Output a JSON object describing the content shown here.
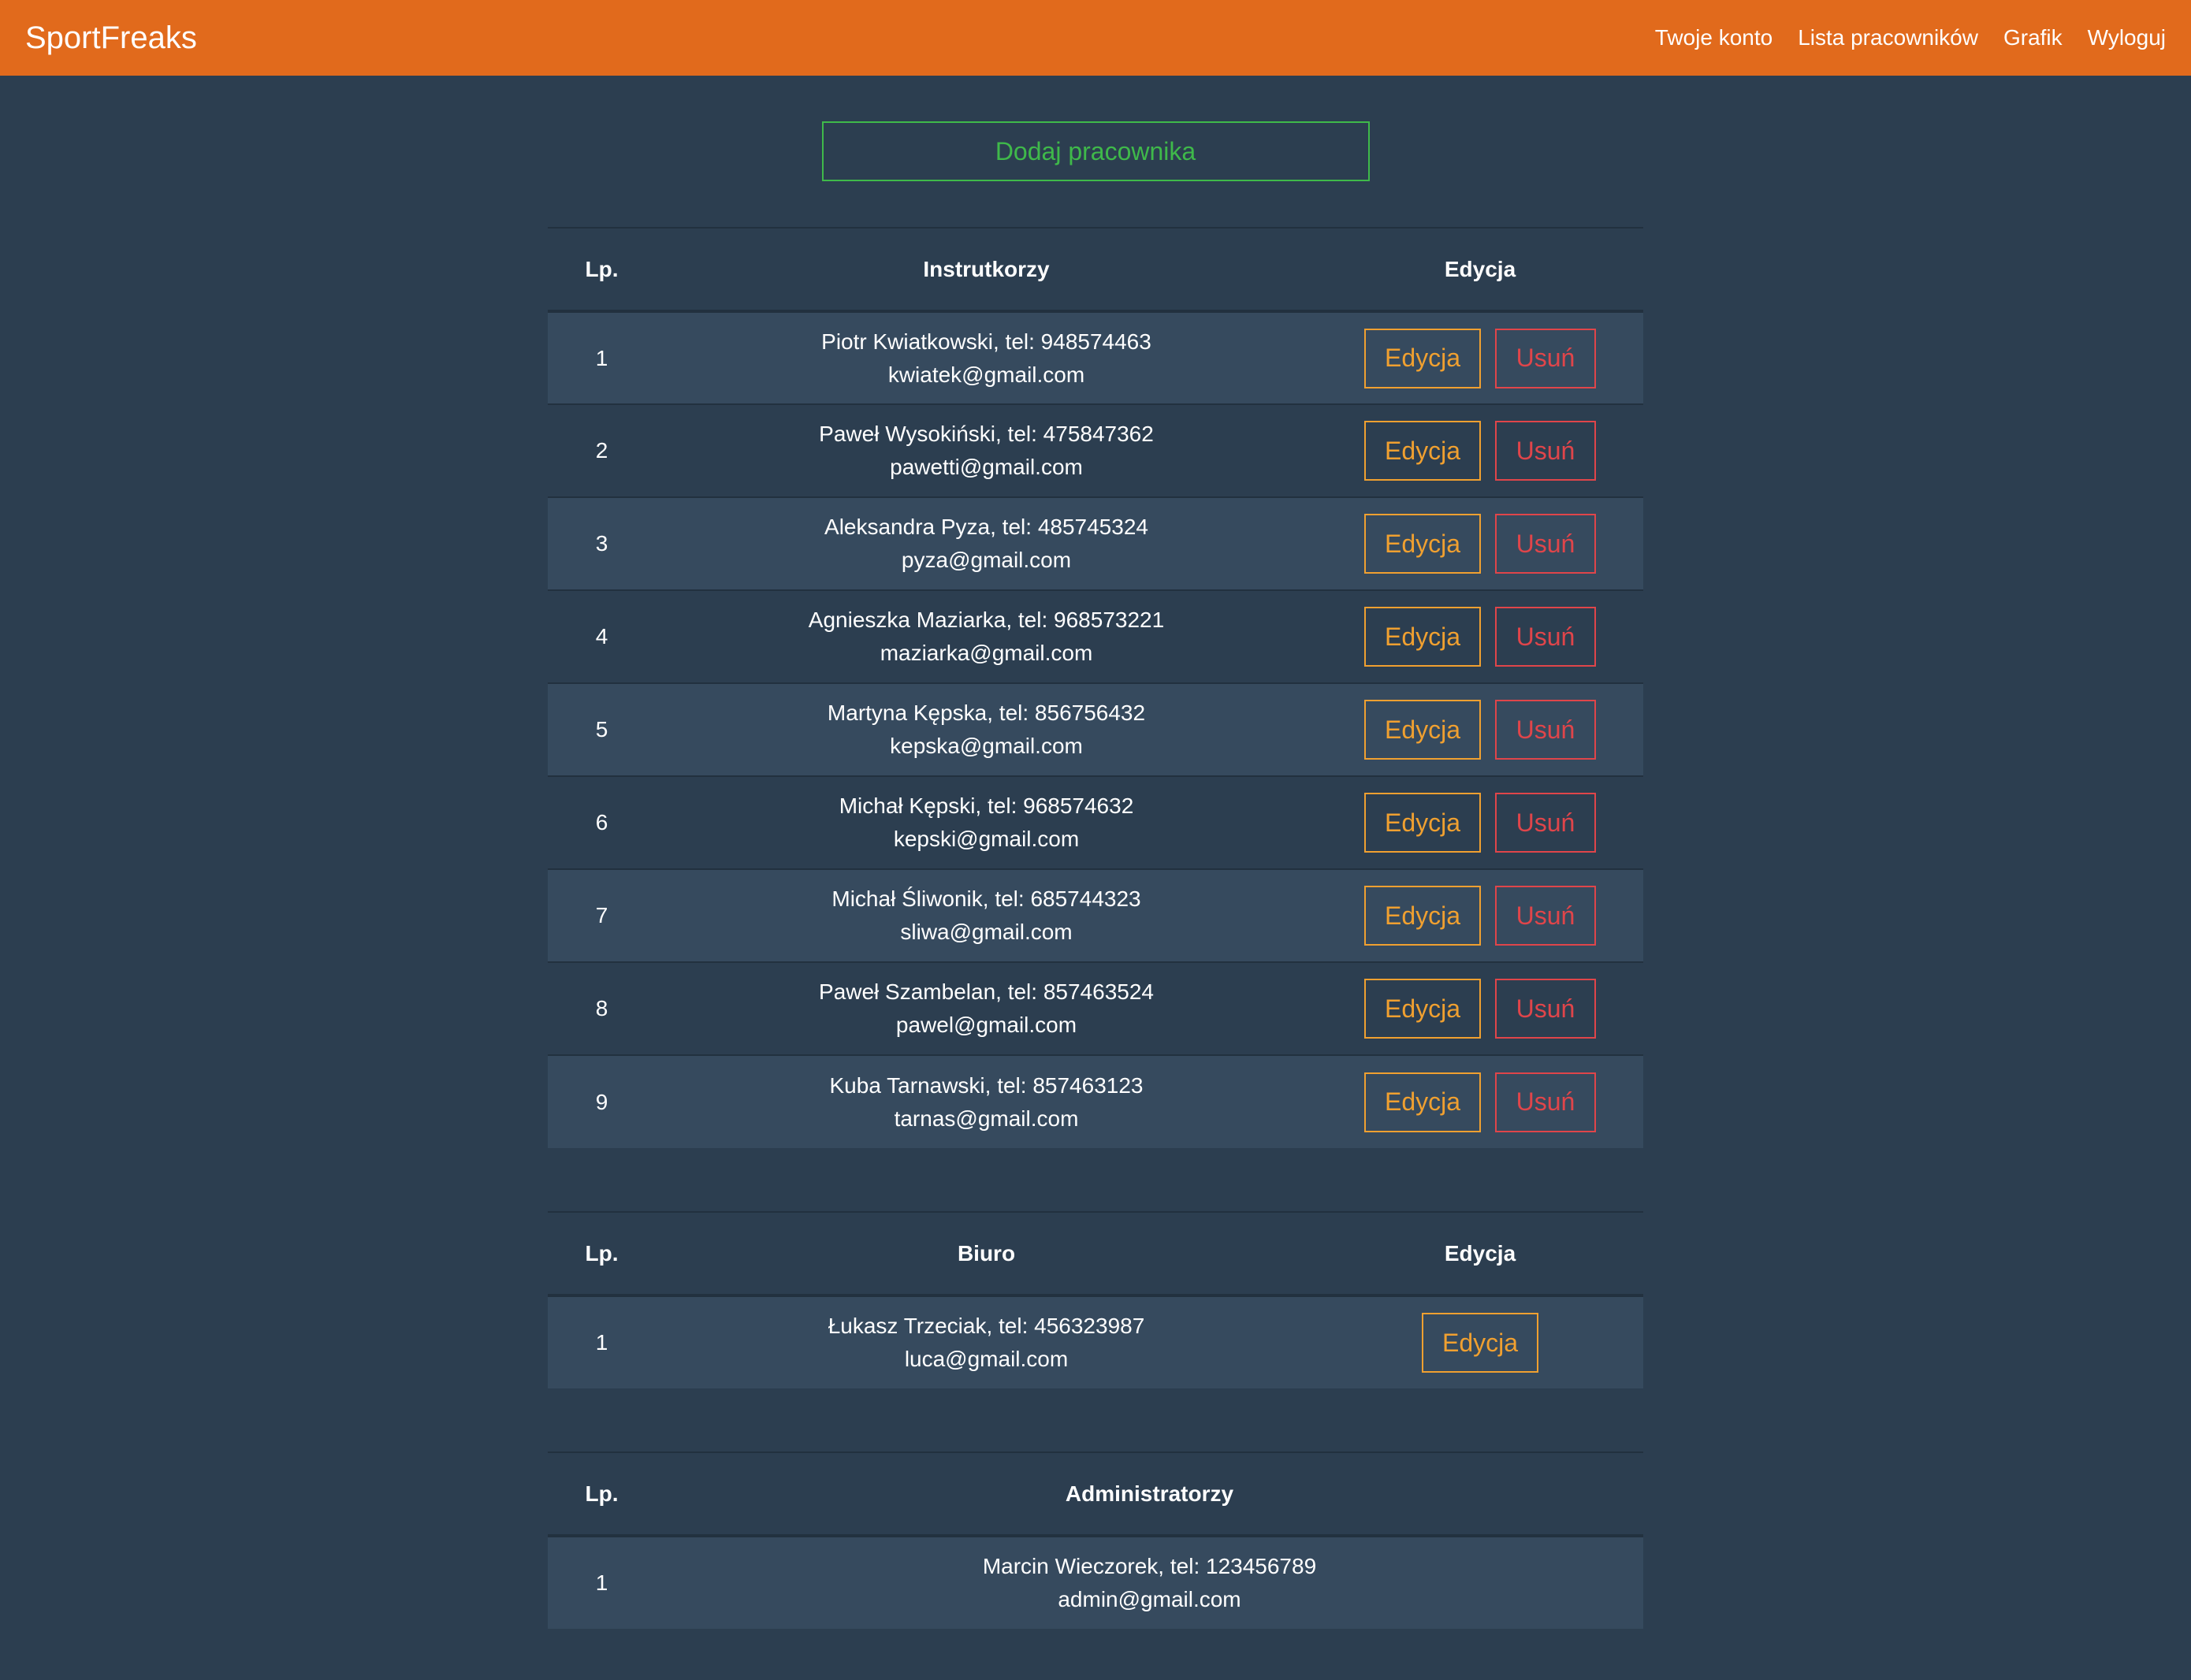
{
  "navbar": {
    "brand": "SportFreaks",
    "links": [
      "Twoje konto",
      "Lista pracowników",
      "Grafik",
      "Wyloguj"
    ]
  },
  "add_button": "Dodaj pracownika",
  "instructors": {
    "headers": {
      "lp": "Lp.",
      "name": "Instrutkorzy",
      "edit": "Edycja"
    },
    "edit_label": "Edycja",
    "delete_label": "Usuń",
    "rows": [
      {
        "lp": "1",
        "name": "Piotr Kwiatkowski, tel: 948574463",
        "email": "kwiatek@gmail.com"
      },
      {
        "lp": "2",
        "name": "Paweł Wysokiński, tel: 475847362",
        "email": "pawetti@gmail.com"
      },
      {
        "lp": "3",
        "name": "Aleksandra Pyza, tel: 485745324",
        "email": "pyza@gmail.com"
      },
      {
        "lp": "4",
        "name": "Agnieszka Maziarka, tel: 968573221",
        "email": "maziarka@gmail.com"
      },
      {
        "lp": "5",
        "name": "Martyna Kępska, tel: 856756432",
        "email": "kepska@gmail.com"
      },
      {
        "lp": "6",
        "name": "Michał Kępski, tel: 968574632",
        "email": "kepski@gmail.com"
      },
      {
        "lp": "7",
        "name": "Michał Śliwonik, tel: 685744323",
        "email": "sliwa@gmail.com"
      },
      {
        "lp": "8",
        "name": "Paweł Szambelan, tel: 857463524",
        "email": "pawel@gmail.com"
      },
      {
        "lp": "9",
        "name": "Kuba Tarnawski, tel: 857463123",
        "email": "tarnas@gmail.com"
      }
    ]
  },
  "office": {
    "headers": {
      "lp": "Lp.",
      "name": "Biuro",
      "edit": "Edycja"
    },
    "edit_label": "Edycja",
    "rows": [
      {
        "lp": "1",
        "name": "Łukasz Trzeciak, tel: 456323987",
        "email": "luca@gmail.com"
      }
    ]
  },
  "admins": {
    "headers": {
      "lp": "Lp.",
      "name": "Administratorzy"
    },
    "rows": [
      {
        "lp": "1",
        "name": "Marcin Wieczorek, tel: 123456789",
        "email": "admin@gmail.com"
      }
    ]
  },
  "colors": {
    "navbar": "#e16a1c",
    "background": "#2c3e50",
    "row_stripe": "#364a5e",
    "add_accent": "#3fb94a",
    "edit_accent": "#f0a030",
    "delete_accent": "#e0454a"
  }
}
